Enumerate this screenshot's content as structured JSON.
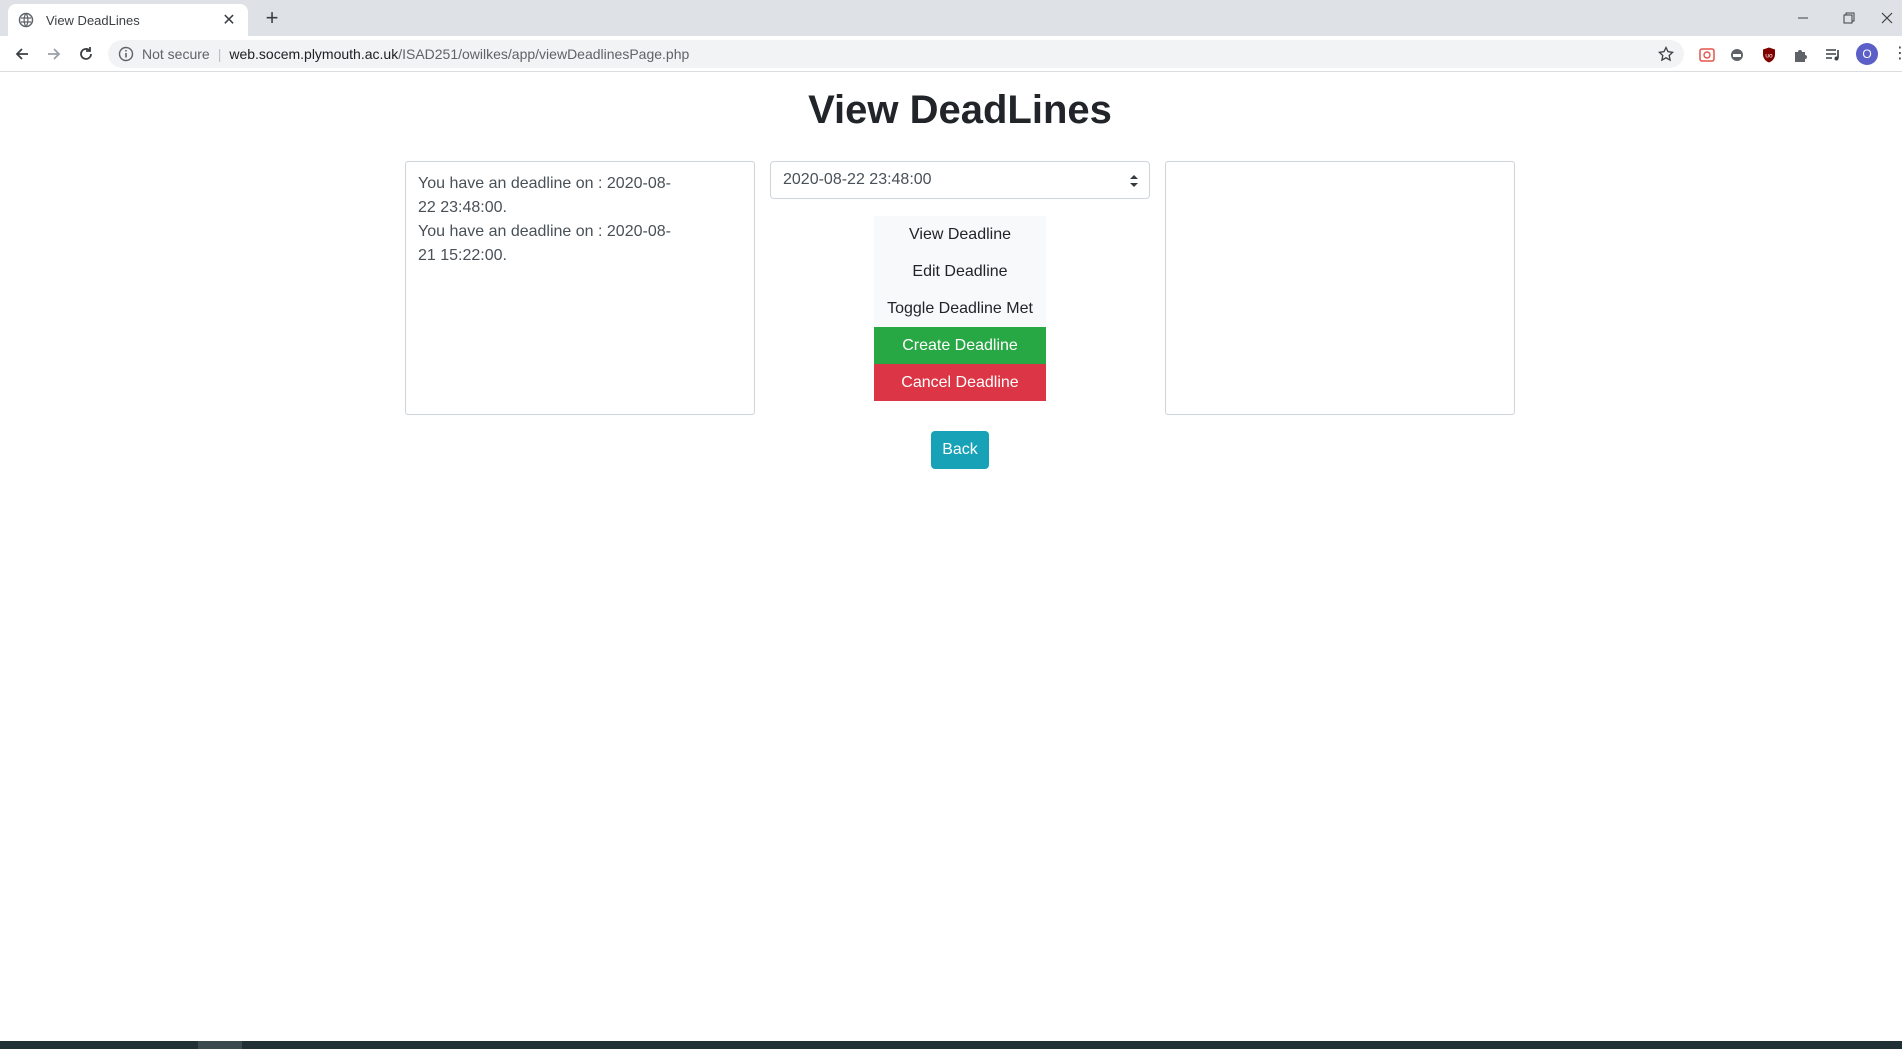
{
  "browser": {
    "tab_title": "View DeadLines",
    "security_label": "Not secure",
    "url_host": "web.socem.plymouth.ac.uk",
    "url_path": "/ISAD251/owilkes/app/viewDeadlinesPage.php",
    "profile_initial": "O"
  },
  "page": {
    "title": "View DeadLines",
    "deadline_messages": [
      "You have an deadline on : 2020-08-22 23:48:00.",
      "You have an deadline on : 2020-08-21 15:22:00."
    ],
    "select": {
      "selected": "2020-08-22 23:48:00"
    },
    "buttons": {
      "view": "View Deadline",
      "edit": "Edit Deadline",
      "toggle": "Toggle Deadline Met",
      "create": "Create Deadline",
      "cancel": "Cancel Deadline",
      "back": "Back"
    }
  },
  "colors": {
    "success": "#28a745",
    "danger": "#dc3545",
    "info": "#17a2b8",
    "light": "#f8f9fa"
  }
}
